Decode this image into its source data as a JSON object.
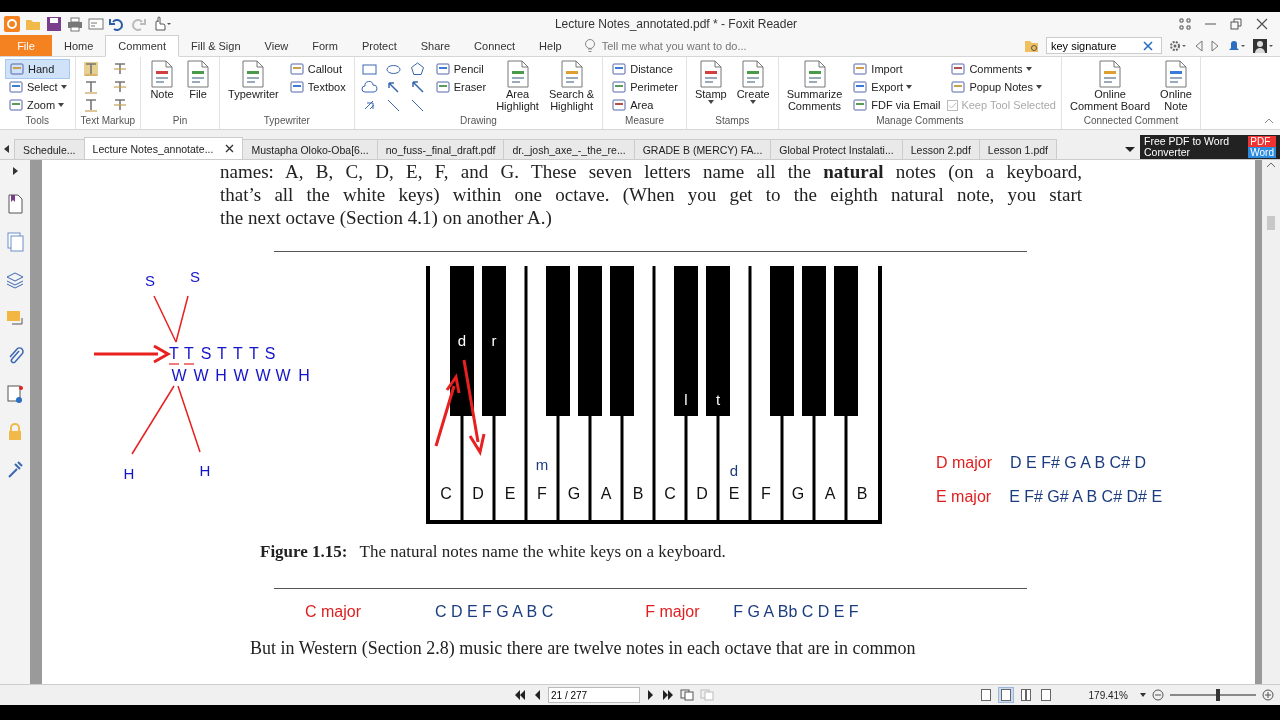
{
  "window": {
    "title": "Lecture Notes_annotated.pdf * - Foxit Reader"
  },
  "menu_tabs": [
    {
      "label": "File",
      "kind": "file",
      "selected": false
    },
    {
      "label": "Home",
      "kind": "tab",
      "selected": false
    },
    {
      "label": "Comment",
      "kind": "tab",
      "selected": true
    },
    {
      "label": "Fill & Sign",
      "kind": "tab",
      "selected": false
    },
    {
      "label": "View",
      "kind": "tab",
      "selected": false
    },
    {
      "label": "Form",
      "kind": "tab",
      "selected": false
    },
    {
      "label": "Protect",
      "kind": "tab",
      "selected": false
    },
    {
      "label": "Share",
      "kind": "tab",
      "selected": false
    },
    {
      "label": "Connect",
      "kind": "tab",
      "selected": false
    },
    {
      "label": "Help",
      "kind": "tab",
      "selected": false
    }
  ],
  "tell_me": {
    "placeholder": "Tell me what you want to do..."
  },
  "search": {
    "value": "key signature"
  },
  "ribbon": [
    {
      "label": "Tools",
      "items": [
        {
          "label": "Hand",
          "kind": "small",
          "selected": true
        },
        {
          "label": "Select",
          "kind": "small",
          "dropdown": true,
          "selected": false
        },
        {
          "label": "Zoom",
          "kind": "small",
          "dropdown": true,
          "selected": false
        }
      ]
    },
    {
      "label": "Text Markup",
      "items": [
        {
          "kind": "icon"
        },
        {
          "kind": "icon"
        },
        {
          "kind": "icon"
        },
        {
          "kind": "icon"
        },
        {
          "kind": "icon"
        },
        {
          "kind": "icon"
        }
      ]
    },
    {
      "label": "Pin",
      "items": [
        {
          "label": "Note",
          "kind": "large"
        },
        {
          "label": "File",
          "kind": "large"
        }
      ]
    },
    {
      "label": "Typewriter",
      "items": [
        {
          "label": "Typewriter",
          "kind": "large"
        },
        {
          "label": "Callout",
          "kind": "small"
        },
        {
          "label": "Textbox",
          "kind": "small"
        }
      ]
    },
    {
      "label": "Drawing",
      "items": [
        {
          "kind": "shape"
        },
        {
          "kind": "shape"
        },
        {
          "kind": "shape"
        },
        {
          "kind": "shape"
        },
        {
          "kind": "shape"
        },
        {
          "kind": "shape"
        },
        {
          "kind": "shape"
        },
        {
          "kind": "shape"
        },
        {
          "kind": "shape"
        },
        {
          "label": "Pencil",
          "kind": "small"
        },
        {
          "label": "Eraser",
          "kind": "small"
        },
        {
          "label": "Area\nHighlight",
          "kind": "large"
        },
        {
          "label": "Search &\nHighlight",
          "kind": "large"
        }
      ]
    },
    {
      "label": "Measure",
      "items": [
        {
          "label": "Distance",
          "kind": "small"
        },
        {
          "label": "Perimeter",
          "kind": "small"
        },
        {
          "label": "Area",
          "kind": "small"
        }
      ]
    },
    {
      "label": "Stamps",
      "items": [
        {
          "label": "Stamp",
          "kind": "large",
          "dropdown": true
        },
        {
          "label": "Create",
          "kind": "large",
          "dropdown": true
        }
      ]
    },
    {
      "label": "Manage Comments",
      "items": [
        {
          "label": "Summarize\nComments",
          "kind": "large"
        },
        {
          "label": "Import",
          "kind": "small"
        },
        {
          "label": "Export",
          "kind": "small",
          "dropdown": true
        },
        {
          "label": "FDF via Email",
          "kind": "small"
        },
        {
          "label": "Comments",
          "kind": "small",
          "dropdown": true
        },
        {
          "label": "Popup Notes",
          "kind": "small",
          "dropdown": true
        },
        {
          "label": "Keep Tool Selected",
          "kind": "check",
          "checked": true,
          "disabled": true
        }
      ]
    },
    {
      "label": "Connected Comment",
      "items": [
        {
          "label": "Online\nComment Board",
          "kind": "large"
        },
        {
          "label": "Online\nNote",
          "kind": "large"
        }
      ]
    }
  ],
  "doc_tabs": [
    {
      "label": "Schedule...",
      "selected": false
    },
    {
      "label": "Lecture Notes_annotate...",
      "selected": true
    },
    {
      "label": "Mustapha Oloko-Oba[6...",
      "selected": false
    },
    {
      "label": "no_fuss-_final_draft.pdf",
      "selected": false
    },
    {
      "label": "dr._josh_axe_-_the_re...",
      "selected": false
    },
    {
      "label": "GRADE B (MERCY) FA...",
      "selected": false
    },
    {
      "label": "Global Protect Instalati...",
      "selected": false
    },
    {
      "label": "Lesson 2.pdf",
      "selected": false
    },
    {
      "label": "Lesson 1.pdf",
      "selected": false
    }
  ],
  "ad": {
    "text": "Free PDF to Word Converter",
    "badge_top": "PDF",
    "badge_bottom": "Word"
  },
  "page": {
    "lines": [
      "names: A, B, C, D, E, F, and G. These seven letters name all the **natural** notes (on a keyboard,",
      "that’s all the white keys) within one octave.  (When you get to the eighth natural note, you start",
      "the next octave (Section 4.1) on another A.)"
    ],
    "step_diagram": {
      "top": [
        "S",
        "S"
      ],
      "steps": [
        {
          "label": "T",
          "underlined": true
        },
        {
          "label": "T",
          "underlined": true
        },
        {
          "label": "S",
          "underlined": false
        },
        {
          "label": "T",
          "underlined": false
        },
        {
          "label": "T",
          "underlined": false
        },
        {
          "label": "T",
          "underlined": false
        },
        {
          "label": "S",
          "underlined": false
        }
      ],
      "intervals": [
        "W",
        "W",
        "H",
        "W",
        "W",
        "W",
        "H"
      ],
      "bottom": [
        "H",
        "H"
      ]
    },
    "keyboard": {
      "white_keys": [
        {
          "note": "C",
          "black_key_solfege": "d"
        },
        {
          "note": "D",
          "black_key_solfege": "r"
        },
        {
          "note": "E"
        },
        {
          "note": "F",
          "solfege": "m"
        },
        {
          "note": "G"
        },
        {
          "note": "A"
        },
        {
          "note": "B"
        },
        {
          "note": "C",
          "black_key_solfege": "l"
        },
        {
          "note": "D",
          "black_key_solfege": "t"
        },
        {
          "note": "E",
          "solfege": "d"
        },
        {
          "note": "F"
        },
        {
          "note": "G"
        },
        {
          "note": "A"
        },
        {
          "note": "B"
        }
      ]
    },
    "side_scales": [
      {
        "name": "D major",
        "notes": "D E F# G A B C# D"
      },
      {
        "name": "E major",
        "notes": "E F# G# A B C# D# E"
      }
    ],
    "caption": {
      "label": "Figure 1.15:",
      "text": "The natural notes name the white keys on a keyboard."
    },
    "bottom_scales": [
      {
        "name": "C major",
        "notes": "C D E F G A B C"
      },
      {
        "name": "F major",
        "notes": "F G A Bb C D E F"
      }
    ],
    "after": "But in Western (Section 2.8) music there are twelve notes in each octave that are in common"
  },
  "status_bar": {
    "page": "21 / 277",
    "view_modes": [
      {
        "selected": false
      },
      {
        "selected": true
      },
      {
        "selected": false
      },
      {
        "selected": false
      }
    ],
    "zoom": "179.41%",
    "zoom_slider": {
      "level": 0.56
    }
  }
}
